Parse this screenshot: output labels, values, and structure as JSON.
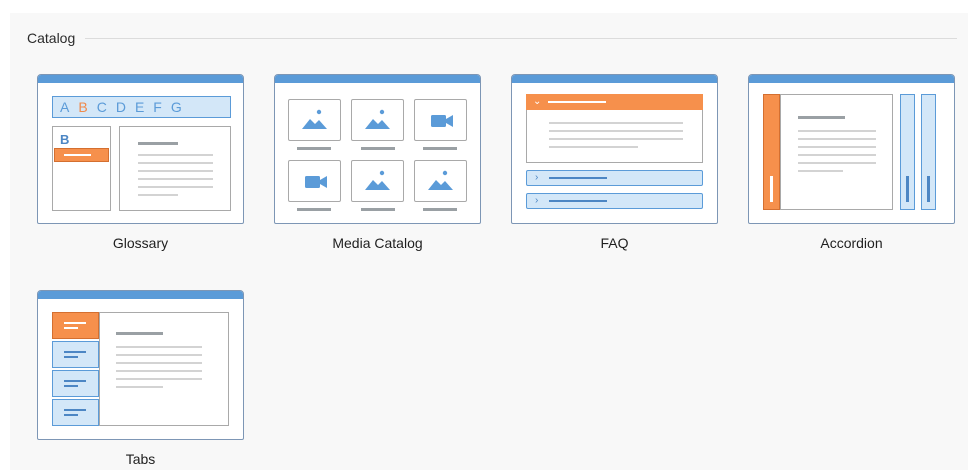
{
  "section": {
    "title": "Catalog"
  },
  "tiles": [
    {
      "label": "Glossary"
    },
    {
      "label": "Media Catalog"
    },
    {
      "label": "FAQ"
    },
    {
      "label": "Accordion"
    },
    {
      "label": "Tabs"
    }
  ],
  "glossary": {
    "letters": [
      "A",
      "B",
      "C",
      "D",
      "E",
      "F",
      "G"
    ],
    "active_letter": "B",
    "group_letter": "B"
  },
  "media": {
    "items": [
      "image-icon",
      "image-icon",
      "video-icon",
      "video-icon",
      "image-icon",
      "image-icon"
    ]
  },
  "colors": {
    "accent_blue": "#5b9bd8",
    "accent_orange": "#f6904c",
    "light_blue": "#d3e7f8",
    "frame": "#7d96b5"
  }
}
